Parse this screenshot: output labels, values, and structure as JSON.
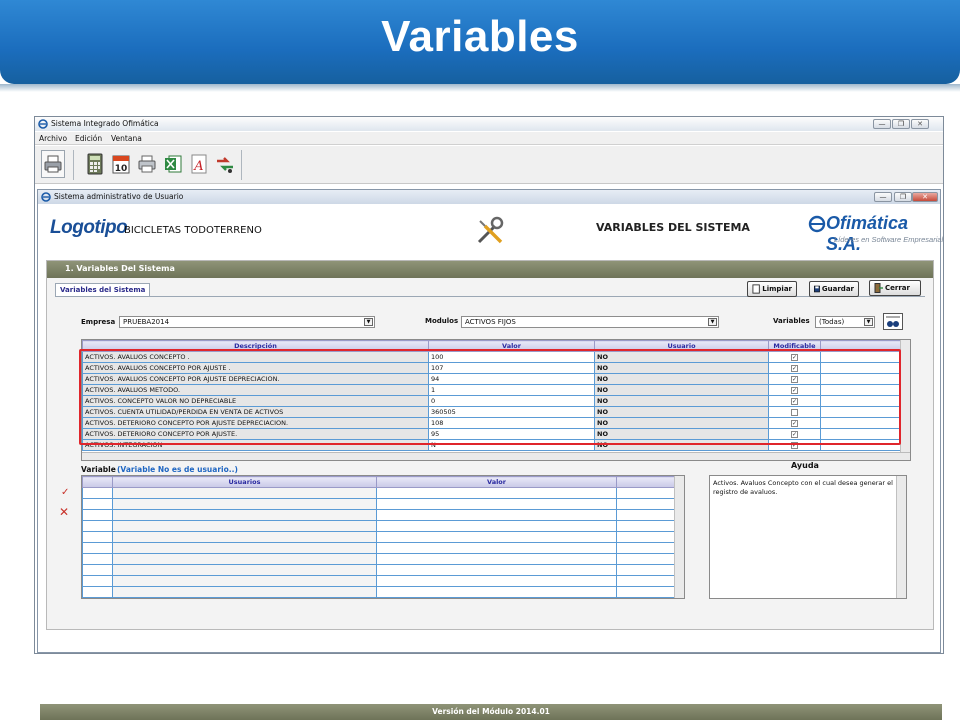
{
  "slide": {
    "title": "Variables"
  },
  "app": {
    "title": "Sistema Integrado Ofimática",
    "window_buttons": {
      "minimize": "—",
      "restore": "❐",
      "close": "✕"
    },
    "menu": [
      "Archivo",
      "Edición",
      "Ventana"
    ]
  },
  "inner_window": {
    "title": "Sistema administrativo de Usuario",
    "window_buttons": {
      "minimize": "—",
      "restore": "❐",
      "close": "✕"
    }
  },
  "banner": {
    "logo": "Logotipo",
    "company": "BICICLETAS TODOTERRENO",
    "module_title": "VARIABLES DEL SISTEMA",
    "brand_name": "Ofimática S.A.",
    "brand_tagline": "Líderes en Software Empresarial"
  },
  "panel": {
    "header": "1. Variables Del Sistema",
    "tab": "Variables del Sistema",
    "buttons": {
      "clear": "Limpiar",
      "save": "Guardar",
      "close": "Cerrar"
    },
    "filters": {
      "empresa_label": "Empresa",
      "empresa_value": "PRUEBA2014",
      "modulos_label": "Modulos",
      "modulos_value": "ACTIVOS FIJOS",
      "variables_label": "Variables",
      "variables_value": "(Todas)"
    }
  },
  "grid": {
    "columns": [
      "Descripción",
      "Valor",
      "Usuario",
      "Modificable"
    ],
    "rows": [
      {
        "descripcion": "ACTIVOS. AVALUOS CONCEPTO .",
        "valor": "100",
        "usuario": "NO",
        "modificable": true
      },
      {
        "descripcion": "ACTIVOS. AVALUOS CONCEPTO POR AJUSTE .",
        "valor": "107",
        "usuario": "NO",
        "modificable": true
      },
      {
        "descripcion": "ACTIVOS. AVALUOS CONCEPTO POR AJUSTE DEPRECIACION.",
        "valor": "94",
        "usuario": "NO",
        "modificable": true
      },
      {
        "descripcion": "ACTIVOS. AVALUOS METODO.",
        "valor": "1",
        "usuario": "NO",
        "modificable": true
      },
      {
        "descripcion": "ACTIVOS. CONCEPTO VALOR NO DEPRECIABLE",
        "valor": "0",
        "usuario": "NO",
        "modificable": true
      },
      {
        "descripcion": "ACTIVOS. CUENTA UTILIDAD/PERDIDA EN VENTA DE ACTIVOS",
        "valor": "360505",
        "usuario": "NO",
        "modificable": false
      },
      {
        "descripcion": "ACTIVOS. DETERIORO CONCEPTO POR AJUSTE DEPRECIACION.",
        "valor": "108",
        "usuario": "NO",
        "modificable": true
      },
      {
        "descripcion": "ACTIVOS. DETERIORO CONCEPTO POR AJUSTE.",
        "valor": "95",
        "usuario": "NO",
        "modificable": true
      },
      {
        "descripcion": "ACTIVOS. INTEGRACION",
        "valor": "N",
        "usuario": "NO",
        "modificable": true
      }
    ]
  },
  "lower": {
    "label": "Variable",
    "note": "(Variable No es de usuario..)",
    "columns": [
      "Usuarios",
      "Valor"
    ],
    "empty_rows": 10
  },
  "help": {
    "label": "Ayuda",
    "text": "Activos. Avaluos Concepto con el cual desea generar el registro de avaluos."
  },
  "footer": {
    "version": "Versión del Módulo 2014.01"
  },
  "colors": {
    "header_blue": "#1b6dbd",
    "panel_olive": "#7f8468",
    "highlight_red": "#e0252b",
    "grid_line": "#5b9bd5"
  }
}
